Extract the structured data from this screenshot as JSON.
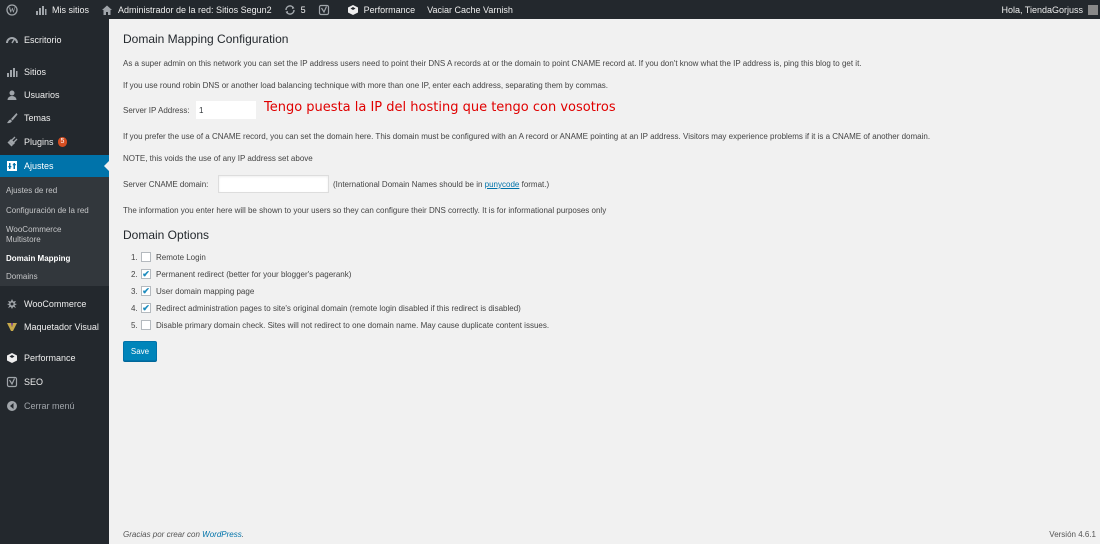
{
  "adminbar": {
    "my_sites": "Mis sitios",
    "network_admin": "Administrador de la red: Sitios Segun2",
    "updates_count": "5",
    "performance": "Performance",
    "purge_varnish": "Vaciar Cache Varnish",
    "greeting": "Hola, TiendaGorjuss"
  },
  "sidebar": {
    "items": [
      {
        "label": "Escritorio",
        "icon": "gauge-icon"
      },
      {
        "label": "Sitios",
        "icon": "sites-icon"
      },
      {
        "label": "Usuarios",
        "icon": "users-icon"
      },
      {
        "label": "Temas",
        "icon": "brush-icon"
      },
      {
        "label": "Plugins",
        "icon": "plug-icon",
        "badge": "5"
      },
      {
        "label": "Ajustes",
        "icon": "settings-icon",
        "active": true
      },
      {
        "label": "WooCommerce",
        "icon": "woocommerce-icon"
      },
      {
        "label": "Maquetador Visual",
        "icon": "visual-builder-icon"
      },
      {
        "label": "Performance",
        "icon": "performance-icon"
      },
      {
        "label": "SEO",
        "icon": "yoast-icon"
      },
      {
        "label": "Cerrar menú",
        "icon": "collapse-icon"
      }
    ],
    "submenu": [
      {
        "label": "Ajustes de red"
      },
      {
        "label": "Configuración de la red"
      },
      {
        "label": "WooCommerce Multistore"
      },
      {
        "label": "Domain Mapping",
        "current": true
      },
      {
        "label": "Domains"
      }
    ]
  },
  "main": {
    "title": "Domain Mapping Configuration",
    "intro": "As a super admin on this network you can set the IP address users need to point their DNS A records at or the domain to point CNAME record at. If you don't know what the IP address is, ping this blog to get it.",
    "round_robin": "If you use round robin DNS or another load balancing technique with more than one IP, enter each address, separating them by commas.",
    "server_ip_label": "Server IP Address:",
    "server_ip_value": "1",
    "annotation": "Tengo puesta la IP del hosting que tengo con vosotros",
    "cname_info": "If you prefer the use of a CNAME record, you can set the domain here. This domain must be configured with an A record or ANAME pointing at an IP address. Visitors may experience problems if it is a CNAME of another domain.",
    "note": "NOTE, this voids the use of any IP address set above",
    "cname_label": "Server CNAME domain:",
    "cname_value": "",
    "idn_prefix": "(International Domain Names should be in",
    "idn_link": "punycode",
    "idn_suffix": "format.)",
    "info_text": "The information you enter here will be shown to your users so they can configure their DNS correctly. It is for informational purposes only",
    "options_title": "Domain Options",
    "options": [
      {
        "num": "1.",
        "label": "Remote Login",
        "checked": false
      },
      {
        "num": "2.",
        "label": "Permanent redirect (better for your blogger's pagerank)",
        "checked": true
      },
      {
        "num": "3.",
        "label": "User domain mapping page",
        "checked": true
      },
      {
        "num": "4.",
        "label": "Redirect administration pages to site's original domain (remote login disabled if this redirect is disabled)",
        "checked": true
      },
      {
        "num": "5.",
        "label": "Disable primary domain check. Sites will not redirect to one domain name. May cause duplicate content issues.",
        "checked": false
      }
    ],
    "save_label": "Save"
  },
  "footer": {
    "thanks_prefix": "Gracias por crear con",
    "thanks_link": "WordPress",
    "thanks_suffix": ".",
    "version": "Versión 4.6.1"
  },
  "colors": {
    "adminbar_bg": "#23282d",
    "accent": "#0073aa",
    "badge": "#d54e21",
    "annotation": "#e00000"
  }
}
